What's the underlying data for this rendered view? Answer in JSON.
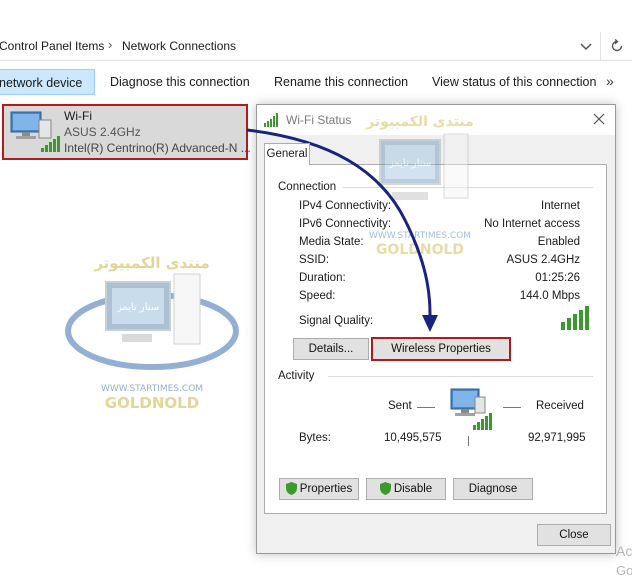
{
  "address_bar": {
    "crumbs": [
      "Control Panel Items",
      "Network Connections"
    ],
    "separator": "›"
  },
  "toolbar": {
    "items": [
      "network device",
      "Diagnose this connection",
      "Rename this connection",
      "View status of this connection"
    ],
    "more": "»"
  },
  "adapter": {
    "name": "Wi-Fi",
    "ssid": "ASUS 2.4GHz",
    "device": "Intel(R) Centrino(R) Advanced-N ..."
  },
  "watermark": {
    "arabic_top": "منتدى الكمبيوتر",
    "arabic_screen": "ستار تايمز",
    "site": "WWW.STARTIMES.COM",
    "brand": "GOLDNOLD"
  },
  "dialog": {
    "title": "Wi-Fi Status",
    "tab": "General",
    "connection": {
      "title": "Connection",
      "rows": [
        {
          "label": "IPv4 Connectivity:",
          "value": "Internet"
        },
        {
          "label": "IPv6 Connectivity:",
          "value": "No Internet access"
        },
        {
          "label": "Media State:",
          "value": "Enabled"
        },
        {
          "label": "SSID:",
          "value": "ASUS 2.4GHz"
        },
        {
          "label": "Duration:",
          "value": "01:25:26"
        },
        {
          "label": "Speed:",
          "value": "144.0 Mbps"
        }
      ],
      "signal_label": "Signal Quality:",
      "signal_bars": 5
    },
    "buttons": {
      "details": "Details...",
      "wireless": "Wireless Properties",
      "properties": "Properties",
      "disable": "Disable",
      "diagnose": "Diagnose",
      "close": "Close"
    },
    "activity": {
      "title": "Activity",
      "sent": "Sent",
      "received": "Received",
      "bytes_label": "Bytes:",
      "bytes_sent": "10,495,575",
      "bytes_received": "92,971,995"
    }
  },
  "faded_text": [
    "Ac",
    "Go"
  ],
  "colors": {
    "highlight": "#b01c1c",
    "arrow": "#1a237e",
    "signal": "#3c9a2c",
    "toolbar_active": "#cce8ff"
  }
}
